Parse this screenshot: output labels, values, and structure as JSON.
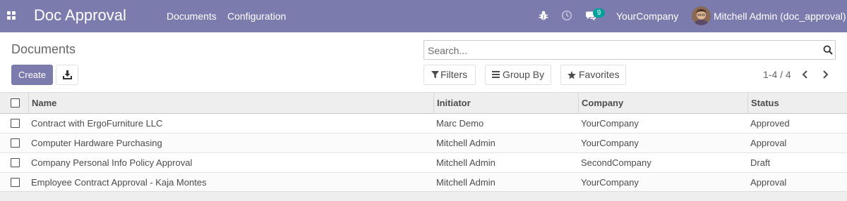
{
  "navbar": {
    "app_title": "Doc Approval",
    "menu": [
      "Documents",
      "Configuration"
    ],
    "chat_count": "9",
    "company": "YourCompany",
    "user": "Mitchell Admin (doc_approval)",
    "icons": {
      "apps": "apps-grid-icon",
      "debug": "bug-icon",
      "activity": "clock-icon",
      "messages": "chat-icon"
    }
  },
  "control_panel": {
    "title": "Documents",
    "create_label": "Create",
    "download_icon": "download-icon",
    "search": {
      "placeholder": "Search...",
      "value": ""
    },
    "filters_label": "Filters",
    "group_by_label": "Group By",
    "favorites_label": "Favorites",
    "pager": "1-4 / 4"
  },
  "table": {
    "columns": [
      "Name",
      "Initiator",
      "Company",
      "Status"
    ],
    "rows": [
      {
        "name": "Contract with ErgoFurniture LLC",
        "initiator": "Marc Demo",
        "company": "YourCompany",
        "status": "Approved"
      },
      {
        "name": "Computer Hardware Purchasing",
        "initiator": "Mitchell Admin",
        "company": "YourCompany",
        "status": "Approval"
      },
      {
        "name": "Company Personal Info Policy Approval",
        "initiator": "Mitchell Admin",
        "company": "SecondCompany",
        "status": "Draft"
      },
      {
        "name": "Employee Contract Approval - Kaja Montes",
        "initiator": "Mitchell Admin",
        "company": "YourCompany",
        "status": "Approval"
      }
    ]
  },
  "colors": {
    "brand": "#7c7bad",
    "badge": "#00a09d",
    "header_bg": "#eeeeee"
  }
}
